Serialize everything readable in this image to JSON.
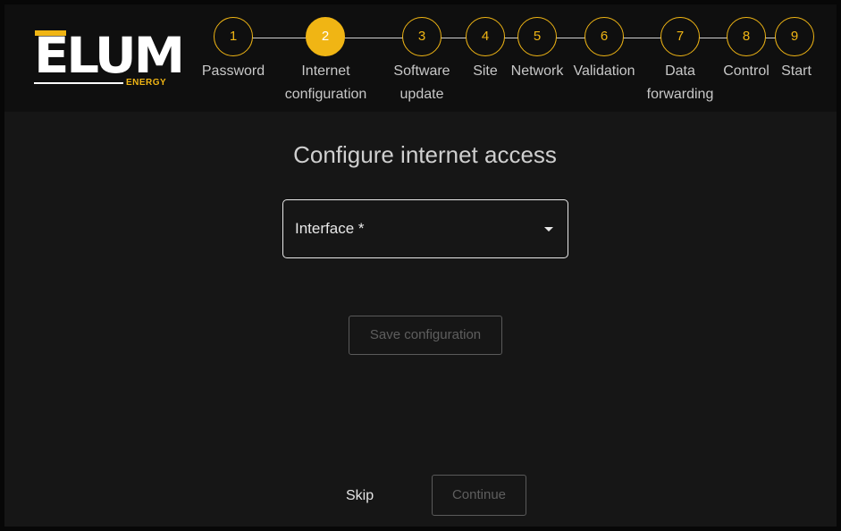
{
  "brand": {
    "name": "ELUM",
    "sub": "ENERGY"
  },
  "stepper": {
    "steps": [
      {
        "number": "1",
        "label": "Password",
        "state": "done"
      },
      {
        "number": "2",
        "label": "Internet configuration",
        "state": "active"
      },
      {
        "number": "3",
        "label": "Software update",
        "state": "todo"
      },
      {
        "number": "4",
        "label": "Site",
        "state": "todo"
      },
      {
        "number": "5",
        "label": "Network",
        "state": "todo"
      },
      {
        "number": "6",
        "label": "Validation",
        "state": "todo"
      },
      {
        "number": "7",
        "label": "Data forwarding",
        "state": "todo"
      },
      {
        "number": "8",
        "label": "Control",
        "state": "todo"
      },
      {
        "number": "9",
        "label": "Start",
        "state": "todo"
      }
    ]
  },
  "main": {
    "title": "Configure internet access",
    "interface_select": {
      "label": "Interface *",
      "value": ""
    },
    "save_button": "Save configuration"
  },
  "footer": {
    "skip": "Skip",
    "continue": "Continue"
  },
  "colors": {
    "accent": "#f0b514",
    "background": "#161616",
    "header": "#0f0f0f",
    "text": "#e8e8e8",
    "disabled": "#5e5e5e"
  }
}
